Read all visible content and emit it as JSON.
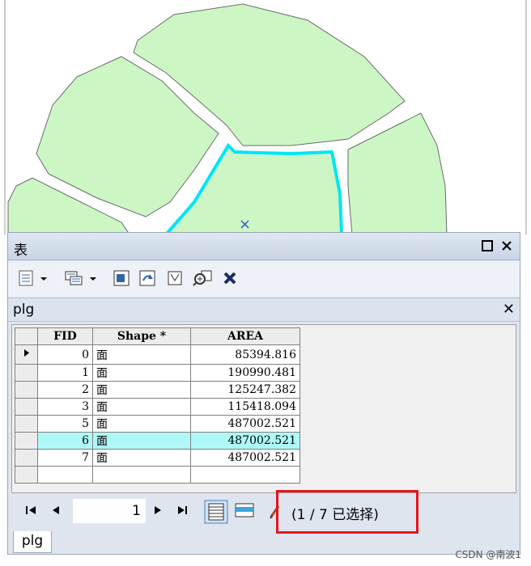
{
  "window": {
    "title": "表"
  },
  "icons": [
    "table-options-icon",
    "related-tables-icon",
    "select-by-attributes-icon",
    "switch-selection-icon",
    "clear-selection-icon",
    "zoom-to-selected-icon",
    "delete-selected-icon",
    "maximize-icon",
    "close-icon"
  ],
  "table": {
    "name": "plg",
    "columns": [
      "FID",
      "Shape *",
      "AREA"
    ],
    "rows": [
      {
        "fid": "0",
        "shape": "面",
        "area": "85394.816",
        "current": true,
        "selected": false
      },
      {
        "fid": "1",
        "shape": "面",
        "area": "190990.481",
        "current": false,
        "selected": false
      },
      {
        "fid": "2",
        "shape": "面",
        "area": "125247.382",
        "current": false,
        "selected": false
      },
      {
        "fid": "3",
        "shape": "面",
        "area": "115418.094",
        "current": false,
        "selected": false
      },
      {
        "fid": "5",
        "shape": "面",
        "area": "487002.521",
        "current": false,
        "selected": false
      },
      {
        "fid": "6",
        "shape": "面",
        "area": "487002.521",
        "current": false,
        "selected": true
      },
      {
        "fid": "7",
        "shape": "面",
        "area": "487002.521",
        "current": false,
        "selected": false
      }
    ]
  },
  "status": {
    "current_record": "1",
    "selection_text": "(1 / 7 已选择)"
  },
  "bottom_tab": "plg",
  "watermark": "CSDN @南波1",
  "colors": {
    "polygon_fill": "#ccf7c5",
    "selected_outline": "#00e5f5",
    "highlight_row": "#aef8f8",
    "annotation_box": "#e8141b"
  }
}
